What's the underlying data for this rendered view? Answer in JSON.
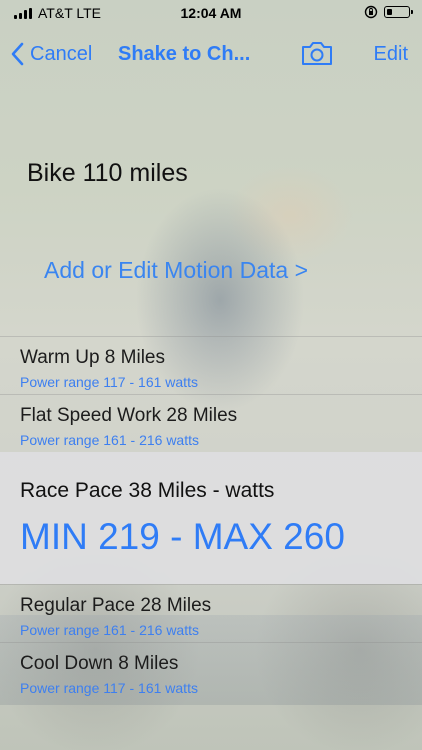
{
  "status_bar": {
    "carrier": "AT&T LTE",
    "time": "12:04 AM"
  },
  "nav": {
    "back_label": "Cancel",
    "title": "Shake to Ch...",
    "edit_label": "Edit",
    "camera_icon": "camera-icon"
  },
  "workout": {
    "heading": "Bike 110 miles",
    "motion_link": "Add or Edit Motion Data  >"
  },
  "segments": [
    {
      "title": "Warm Up 8 Miles",
      "subtitle": "Power range 117 - 161 watts"
    },
    {
      "title": "Flat Speed Work 28 Miles",
      "subtitle": "Power range 161 - 216 watts"
    },
    {
      "title": "Race Pace 38 Miles - watts",
      "range": "MIN 219 - MAX 260"
    },
    {
      "title": "Regular Pace 28 Miles",
      "subtitle": "Power range 161 - 216 watts"
    },
    {
      "title": "Cool Down 8 Miles",
      "subtitle": "Power range 117 - 161 watts"
    }
  ],
  "colors": {
    "accent": "#2f7cf6",
    "selected_bg": "#dedee0"
  }
}
